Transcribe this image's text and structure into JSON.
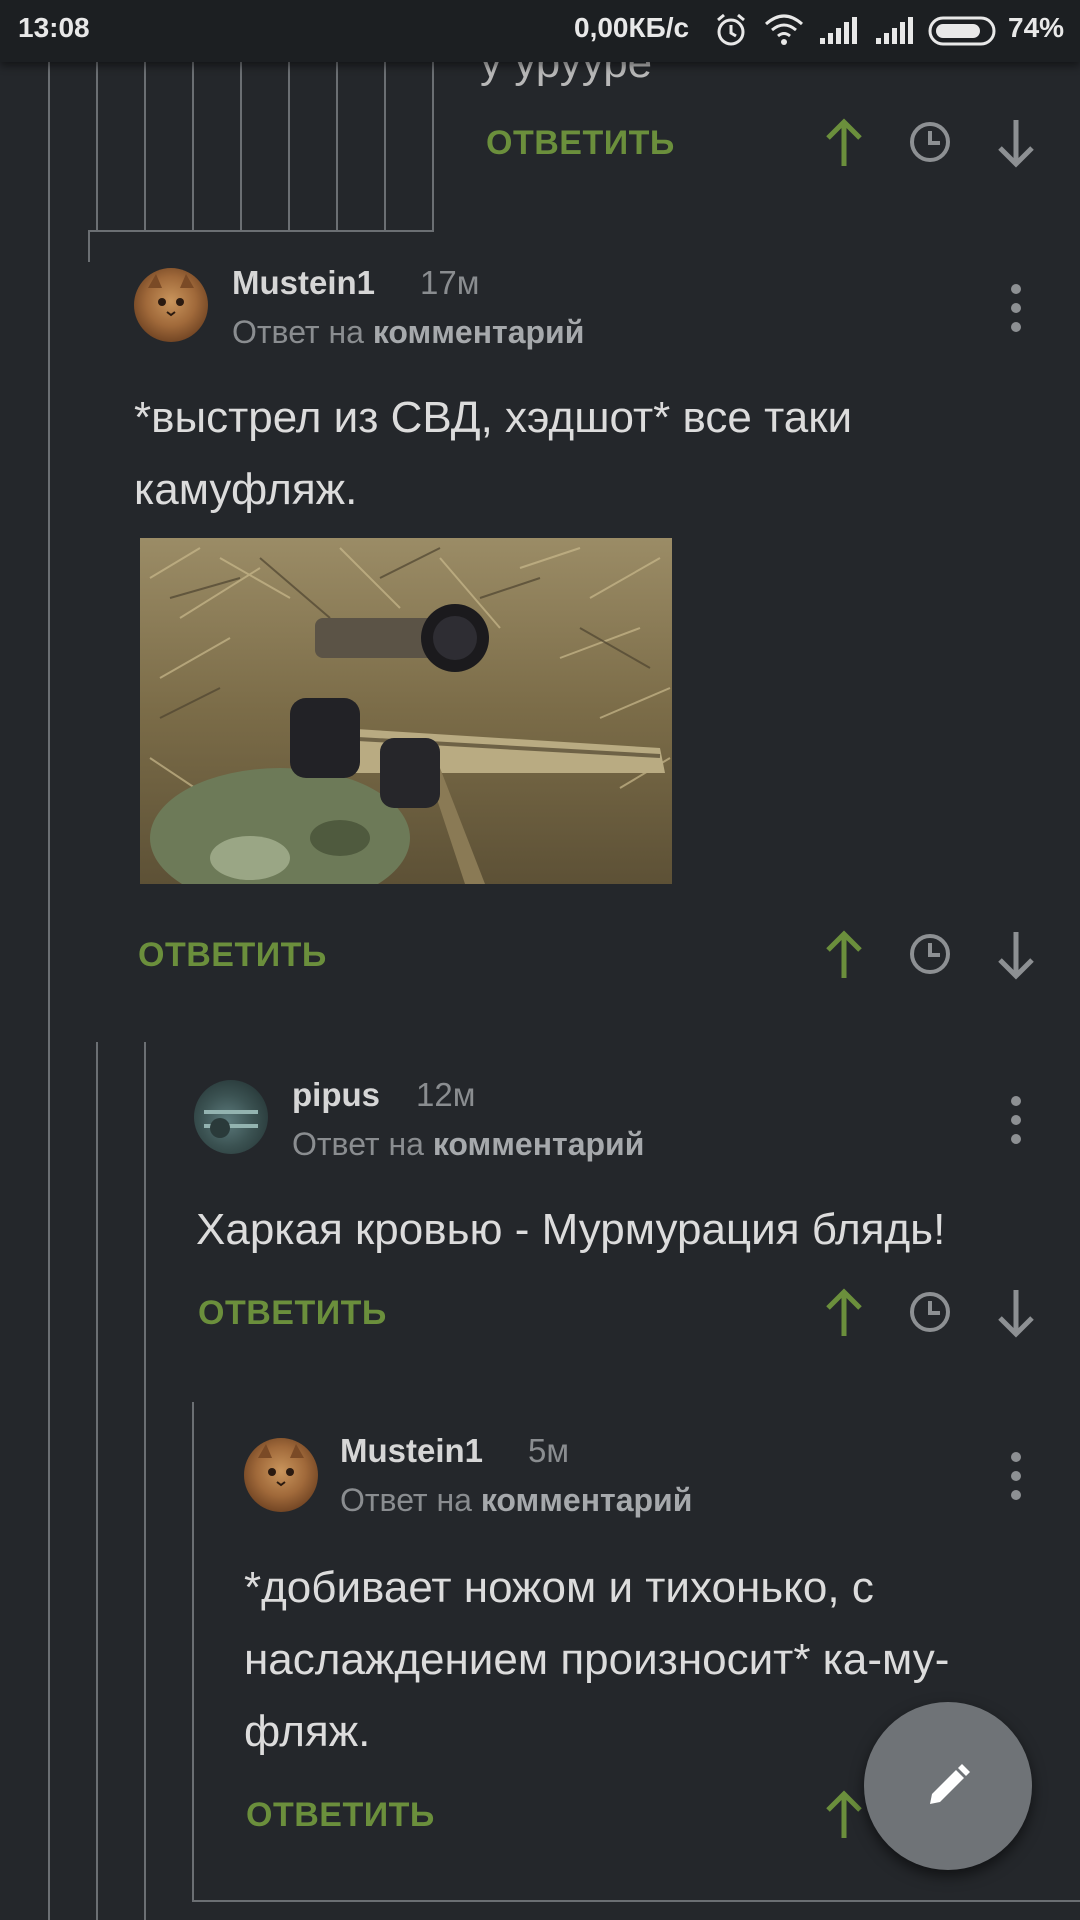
{
  "status_bar": {
    "time": "13:08",
    "network_speed": "0,00КБ/с",
    "battery": "74%"
  },
  "colors": {
    "background": "#24272b",
    "accent_green": "#6b8f3c",
    "thread_line": "#6b6f73",
    "fab": "#6f7377"
  },
  "actions": {
    "reply_label": "ОТВЕТИТЬ"
  },
  "partial_text": "у урууре",
  "comments": [
    {
      "author": "Mustein1",
      "time": "17м",
      "reply_prefix": "Ответ на ",
      "reply_link": "комментарий",
      "text_line1": "*выстрел из СВД, хэдшот* все таки",
      "text_line2": "камуфляж.",
      "has_image": true,
      "image_subject": "sniper in ghillie suit with rifle"
    },
    {
      "author": "pipus",
      "time": "12м",
      "reply_prefix": "Ответ на ",
      "reply_link": "комментарий",
      "text_line1": "Харкая кровью - Мурмурация блядь!"
    },
    {
      "author": "Mustein1",
      "time": "5м",
      "reply_prefix": "Ответ на ",
      "reply_link": "комментарий",
      "text_line1": "*добивает ножом и тихонько, с",
      "text_line2": "наслаждением произносит* ка-му-",
      "text_line3": "фляж."
    }
  ],
  "icons": [
    "upvote-arrow-icon",
    "clock-icon",
    "downvote-arrow-icon",
    "more-vert-icon",
    "pencil-icon",
    "alarm-icon",
    "wifi-icon",
    "signal-icon",
    "battery-icon"
  ]
}
